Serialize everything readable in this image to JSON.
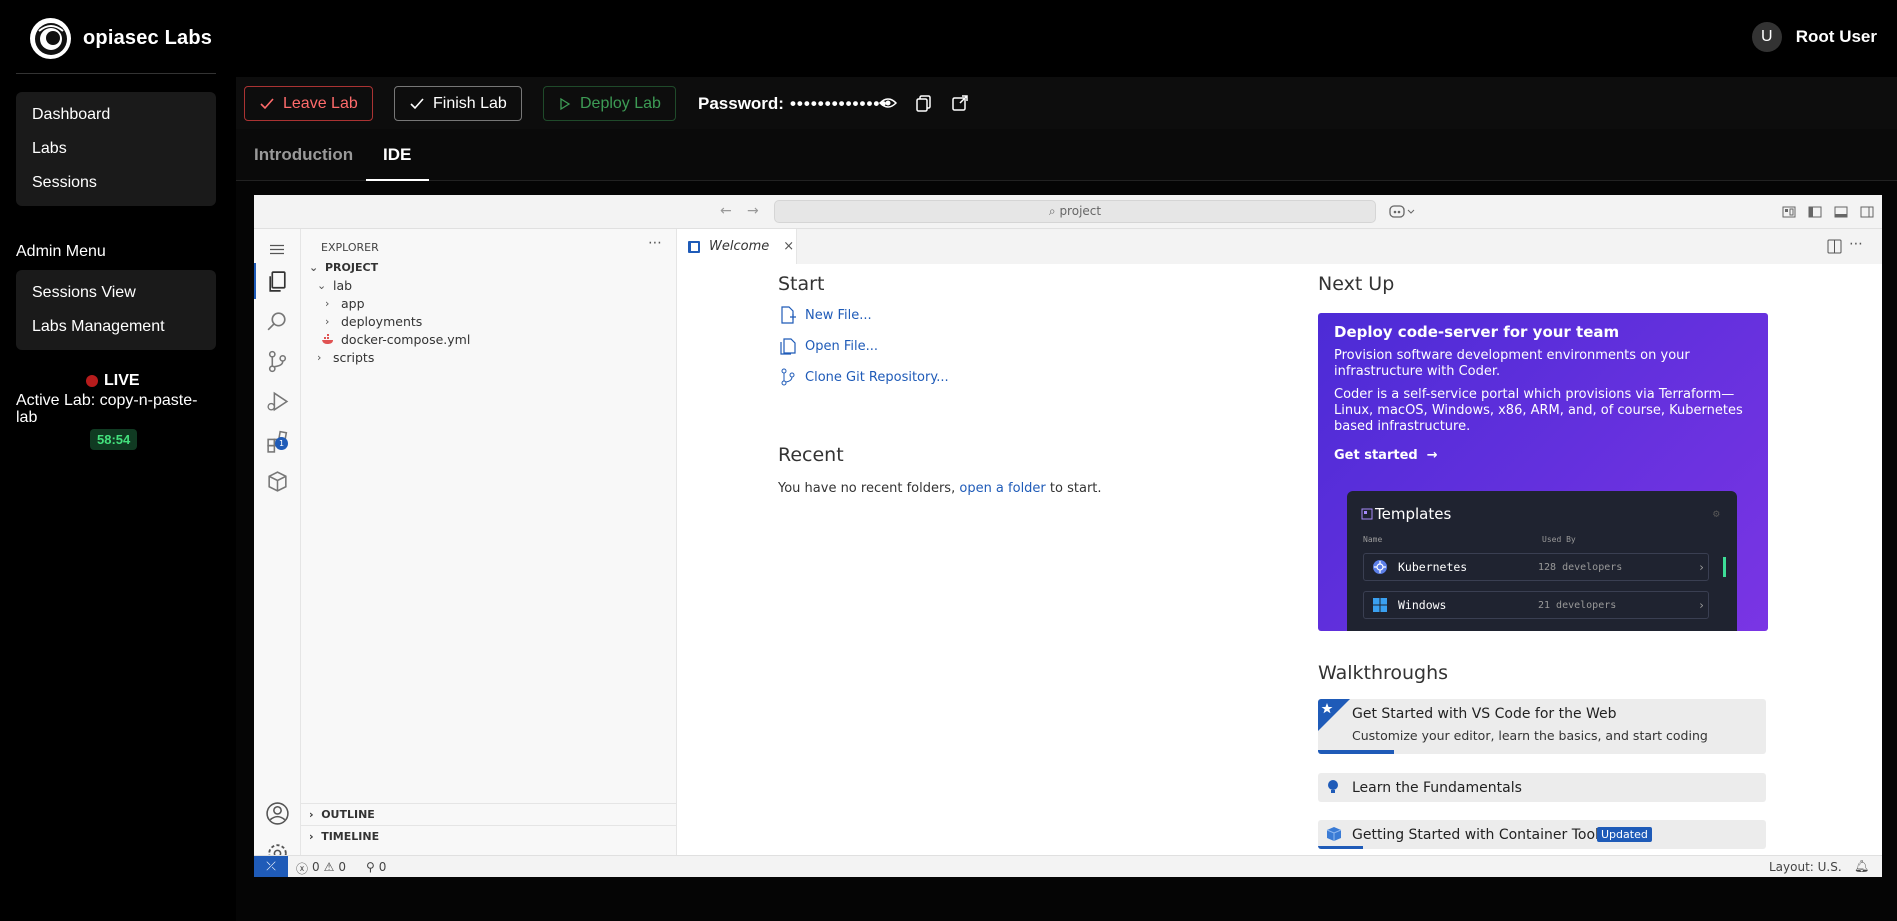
{
  "brand": {
    "name": "opiasec Labs"
  },
  "user": {
    "initial": "U",
    "name": "Root User"
  },
  "nav": {
    "items": [
      "Dashboard",
      "Labs",
      "Sessions"
    ]
  },
  "admin": {
    "title": "Admin Menu",
    "items": [
      "Sessions View",
      "Labs Management"
    ]
  },
  "live": {
    "label": "LIVE",
    "active_lab": "Active Lab: copy-n-paste-lab",
    "timer": "58:54"
  },
  "actions": {
    "leave": "Leave Lab",
    "finish": "Finish Lab",
    "deploy": "Deploy Lab",
    "password_label": "Password:",
    "password_value": "••••••••••••••"
  },
  "tabs": {
    "intro": "Introduction",
    "ide": "IDE"
  },
  "ide": {
    "search": "project",
    "explorer_title": "EXPLORER",
    "project": "PROJECT",
    "tree": [
      "lab",
      "app",
      "deployments",
      "docker-compose.yml",
      "scripts"
    ],
    "outline": "OUTLINE",
    "timeline": "TIMELINE",
    "extensions_badge": "1",
    "welcome_tab": "Welcome",
    "start": {
      "title": "Start",
      "new_file": "New File...",
      "open_file": "Open File...",
      "clone": "Clone Git Repository..."
    },
    "recent": {
      "title": "Recent",
      "text": "You have no recent folders,",
      "link": "open a folder",
      "suffix": "to start."
    },
    "nextup": {
      "title": "Next Up",
      "promo_title": "Deploy code-server for your team",
      "promo_p1": "Provision software development environments on your infrastructure with Coder.",
      "promo_p2": "Coder is a self-service portal which provisions via Terraform—Linux, macOS, Windows, x86, ARM, and, of course, Kubernetes based infrastructure.",
      "promo_cta": "Get started",
      "templates": {
        "title": "Templates",
        "col_name": "Name",
        "col_used": "Used By",
        "rows": [
          {
            "name": "Kubernetes",
            "used": "128 developers"
          },
          {
            "name": "Windows",
            "used": "21 developers"
          }
        ]
      }
    },
    "walkthroughs": {
      "title": "Walkthroughs",
      "items": [
        {
          "title": "Get Started with VS Code for the Web",
          "subtitle": "Customize your editor, learn the basics, and start coding",
          "progress": 0.17
        },
        {
          "title": "Learn the Fundamentals"
        },
        {
          "title": "Getting Started with Container Tools",
          "badge": "Updated",
          "progress": 0.1
        }
      ]
    },
    "status": {
      "errors": "0",
      "warnings": "0",
      "ports": "0",
      "layout": "Layout: U.S."
    }
  },
  "colors": {
    "leave": "#ff6b6b",
    "deploy": "#3d9b55",
    "accent": "#1f5bb8",
    "promo": "#5b2fdf",
    "timer": "#43e07c"
  }
}
